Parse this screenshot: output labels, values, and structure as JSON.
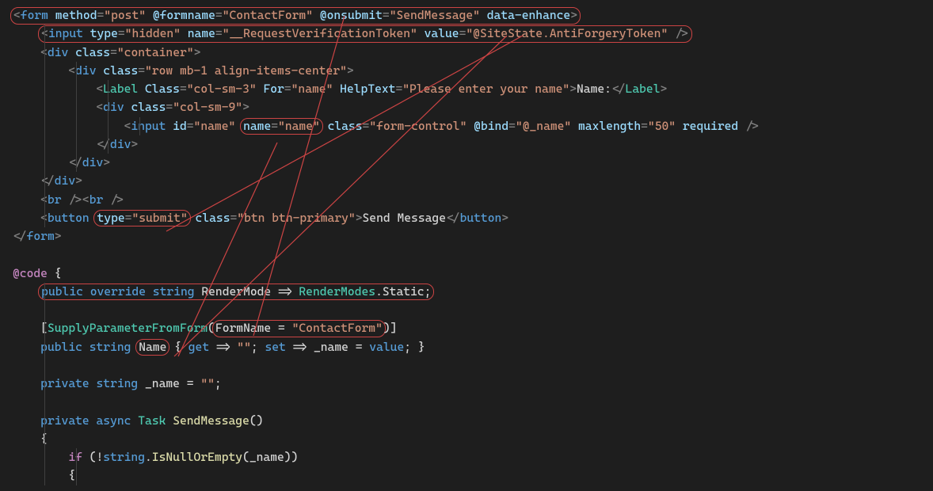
{
  "code": {
    "l1": {
      "form_open": "<form",
      "method_attr": "method",
      "method_val": "\"post\"",
      "formname_attr": "@formname",
      "formname_val": "\"ContactForm\"",
      "onsubmit_attr": "@onsubmit",
      "onsubmit_val": "\"SendMessage\"",
      "enhance": "data-enhance",
      "close": ">"
    },
    "l2": {
      "open": "<input",
      "type_attr": "type",
      "type_val": "\"hidden\"",
      "name_attr": "name",
      "name_val": "\"__RequestVerificationToken\"",
      "value_attr": "value",
      "value_val": "\"@SiteState.AntiForgeryToken\"",
      "close": " />"
    },
    "l3": {
      "open": "<div",
      "class_attr": "class",
      "class_val": "\"container\"",
      "close": ">"
    },
    "l4": {
      "open": "<div",
      "class_attr": "class",
      "class_val": "\"row mb-1 align-items-center\"",
      "close": ">"
    },
    "l5": {
      "open": "<Label",
      "Class_attr": "Class",
      "Class_val": "\"col-sm-3\"",
      "For_attr": "For",
      "For_val": "\"name\"",
      "Help_attr": "HelpText",
      "Help_val": "\"Please enter your name\"",
      "text": "Name:",
      "close_open": ">",
      "close": "</Label>"
    },
    "l6": {
      "open": "<div",
      "class_attr": "class",
      "class_val": "\"col-sm-9\"",
      "close": ">"
    },
    "l7": {
      "open": "<input",
      "id_attr": "id",
      "id_val": "\"name\"",
      "name_attr": "name",
      "name_val": "\"name\"",
      "class_attr": "class",
      "class_val": "\"form-control\"",
      "bind_attr": "@bind",
      "bind_val": "\"@_name\"",
      "max_attr": "maxlength",
      "max_val": "\"50\"",
      "req": "required",
      "close": " />"
    },
    "l8": {
      "text": "</div>"
    },
    "l9": {
      "text": "</div>"
    },
    "l10": {
      "text": "</div>"
    },
    "l11": {
      "text": "<br /><br />"
    },
    "l12": {
      "open": "<button",
      "type_attr": "type",
      "type_val": "\"submit\"",
      "class_attr": "class",
      "class_val": "\"btn btn-primary\"",
      "gt": ">",
      "text": "Send Message",
      "close": "</button>"
    },
    "l13": {
      "text": "</form>"
    },
    "l15": {
      "at": "@code",
      "brace": " {"
    },
    "l16": {
      "public": "public",
      "override": "override",
      "string": "string",
      "name": "RenderMode",
      "arrow": " => ",
      "rm": "RenderModes",
      "dot": ".",
      "stat": "Static",
      "semi": ";"
    },
    "l18": {
      "attr_open": "[",
      "attr_name": "SupplyParameterFromForm",
      "paren": "(",
      "fn": "FormName",
      "eq": " = ",
      "val": "\"ContactForm\"",
      "close": ")]"
    },
    "l19": {
      "public": "public",
      "string": "string",
      "name": "Name",
      "rest": " { ",
      "get": "get",
      "arrow1": " => ",
      "empty": "\"\"",
      "semi1": "; ",
      "set": "set",
      "arrow2": " => ",
      "field": "_name",
      "eq": " = ",
      "val": "value",
      "semi2": "; }"
    },
    "l21": {
      "private": "private",
      "string": "string",
      "name": "_name",
      "eq": " = ",
      "empty": "\"\"",
      "semi": ";"
    },
    "l23": {
      "private": "private",
      "async": "async",
      "task": "Task",
      "name": "SendMessage",
      "parens": "()"
    },
    "l24": {
      "brace": "{"
    },
    "l25": {
      "if": "if",
      "open": " (!",
      "string": "string",
      "dot": ".",
      "meth": "IsNullOrEmpty",
      "p": "(_name))"
    },
    "l26": {
      "brace": "{"
    }
  }
}
